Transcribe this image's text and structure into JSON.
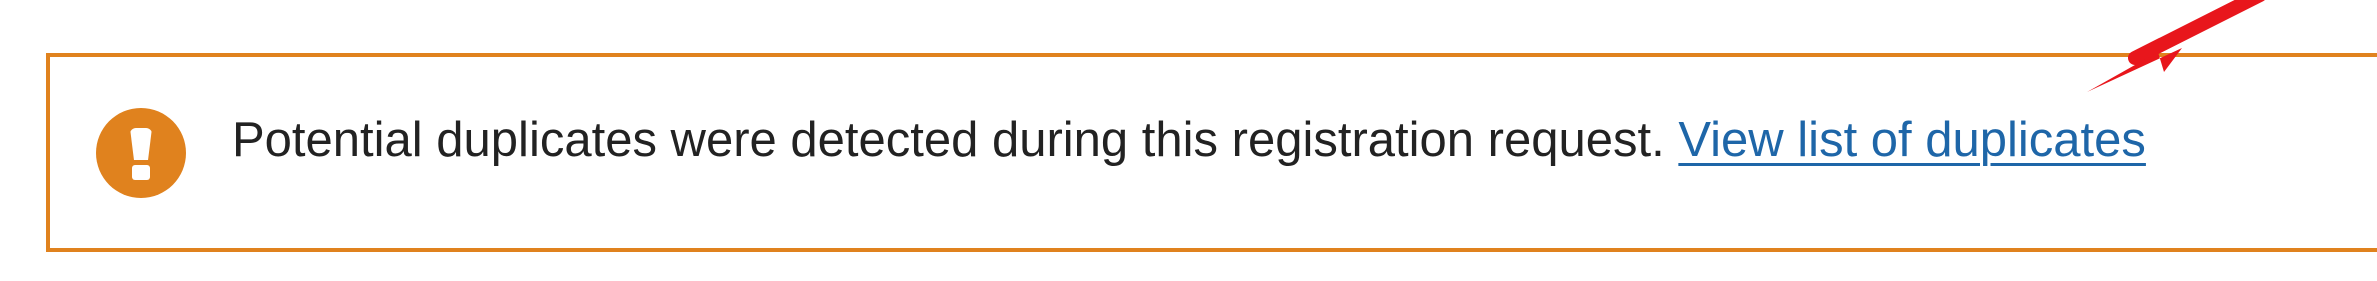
{
  "alert": {
    "message": "Potential duplicates were detected during this registration request.",
    "link_label": "View list of duplicates",
    "icon": "exclamation-icon"
  },
  "colors": {
    "alert_border": "#e0821e",
    "alert_icon": "#e0821e",
    "link": "#1e66a8",
    "annotation_arrow": "#e8161c"
  }
}
